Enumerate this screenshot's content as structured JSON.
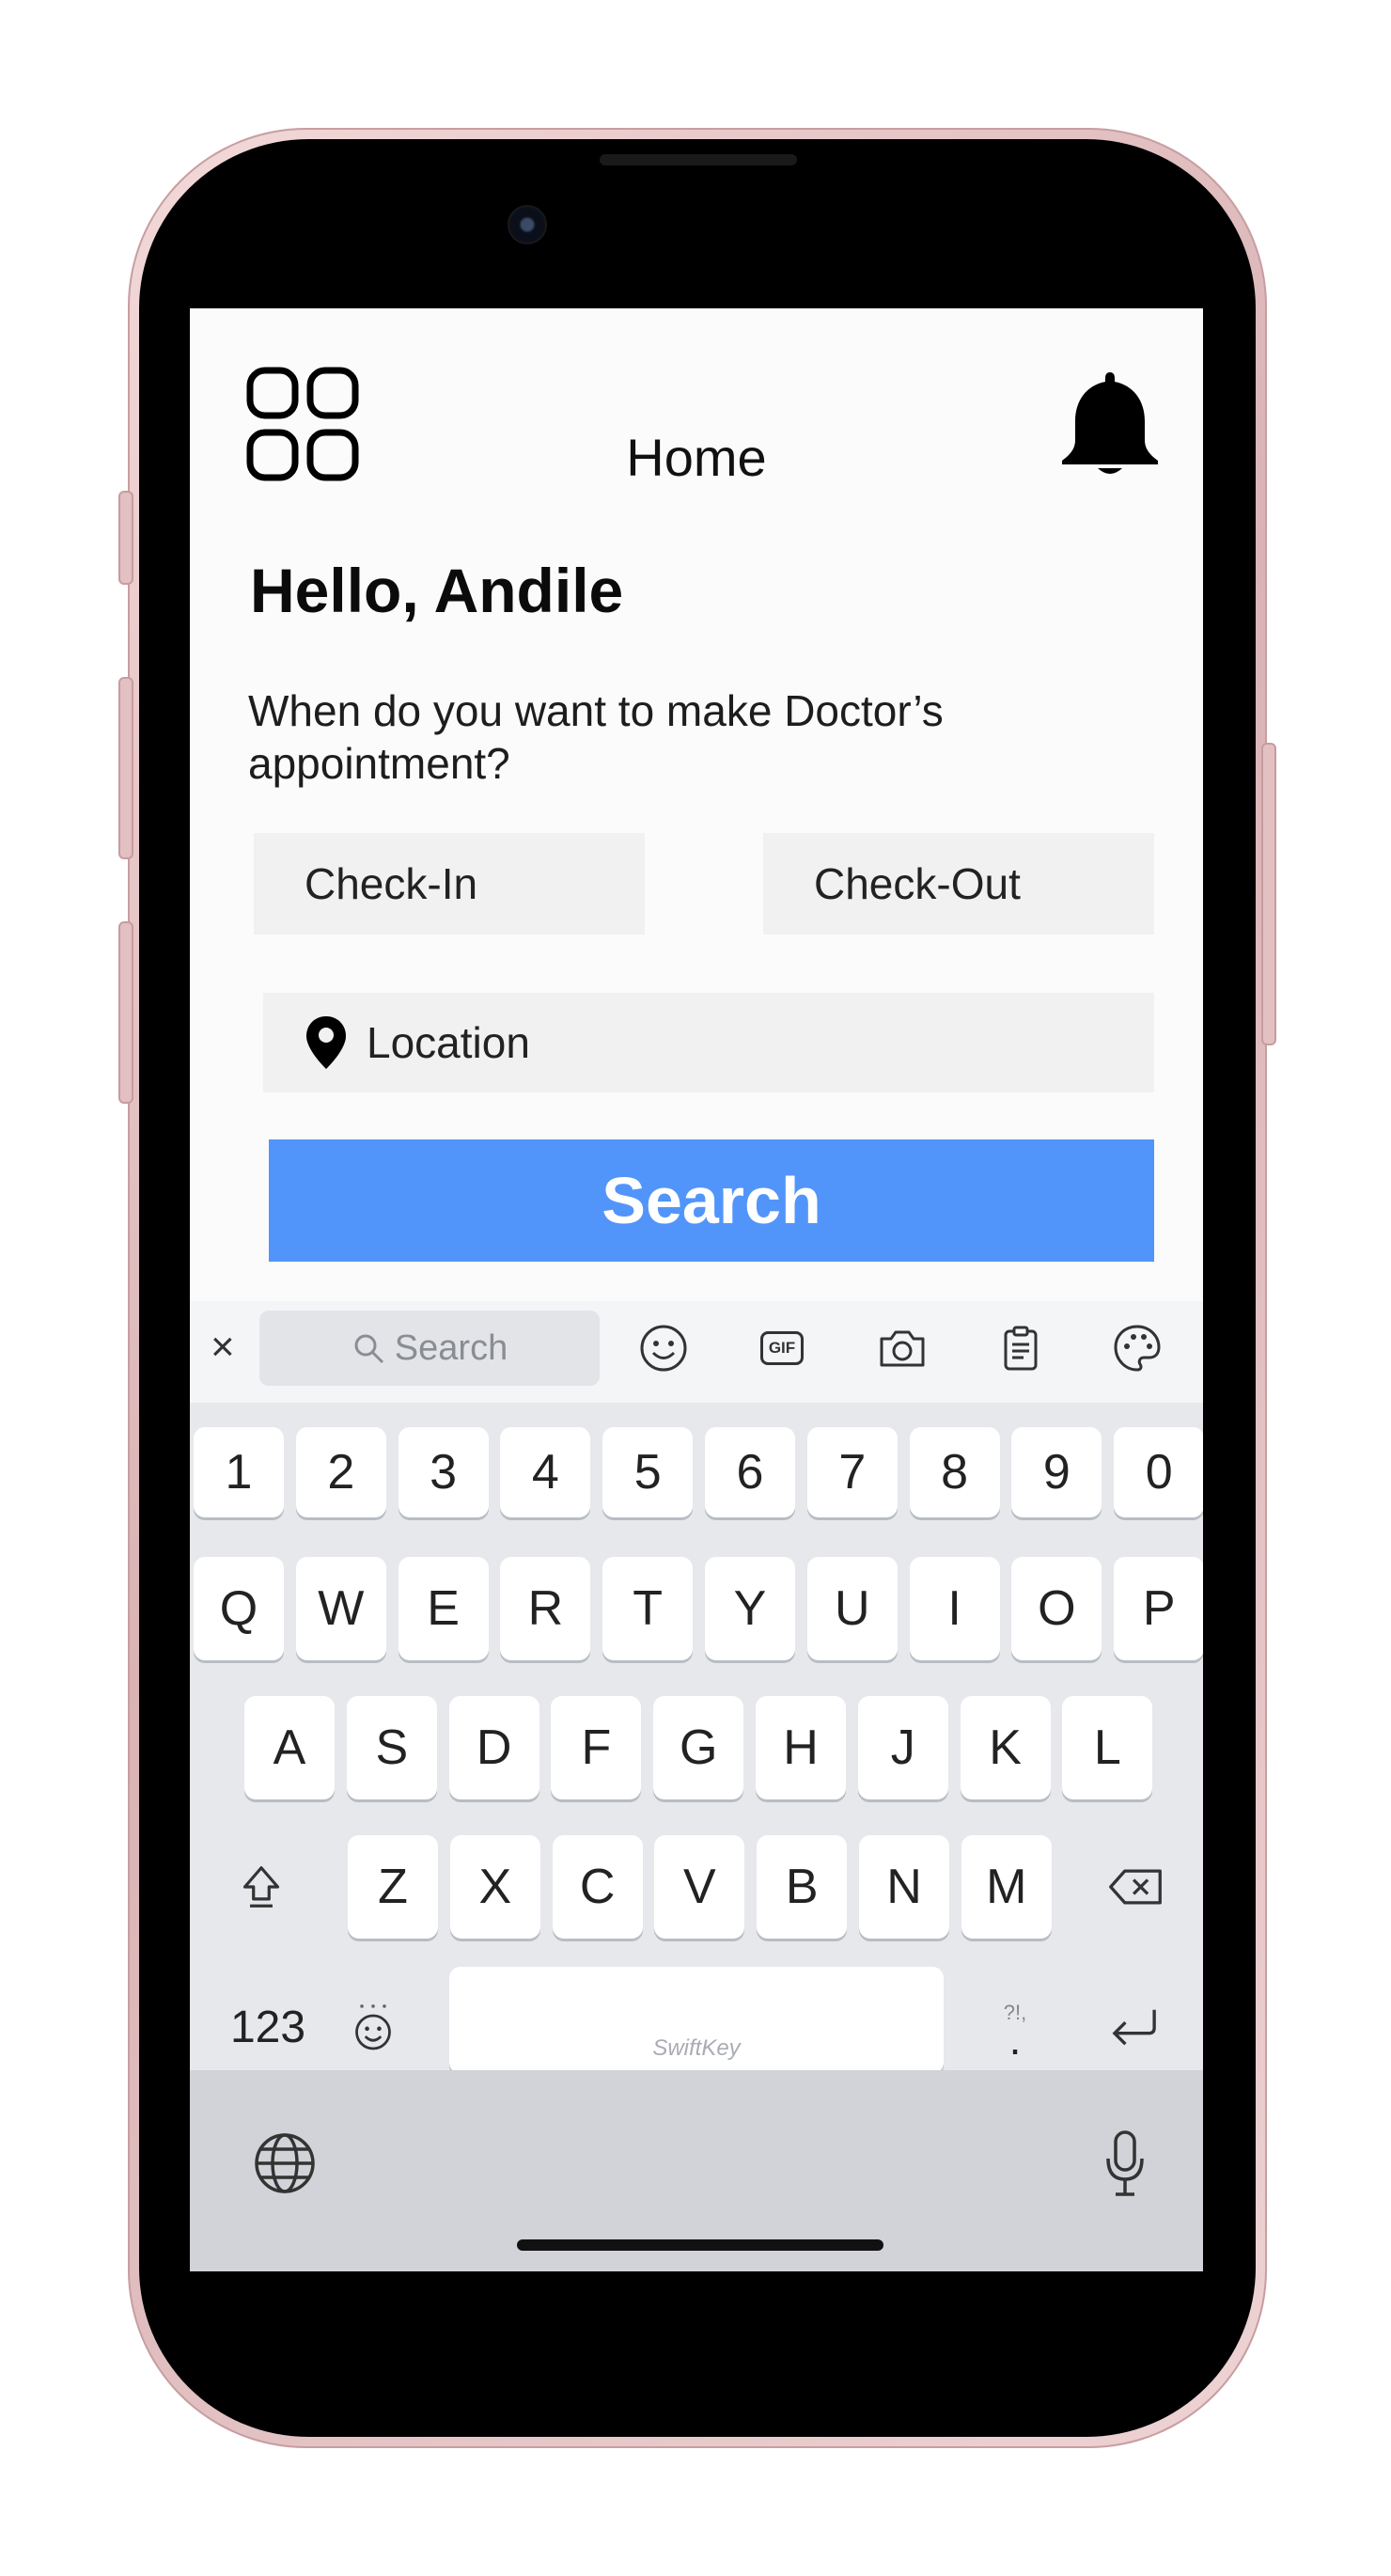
{
  "header": {
    "title": "Home",
    "menu_icon": "grid-menu-icon",
    "notification_icon": "bell-icon"
  },
  "greeting": "Hello, Andile",
  "prompt": "When do you want to make Doctor’s appointment?",
  "fields": {
    "check_in": "Check-In",
    "check_out": "Check-Out",
    "location": "Location"
  },
  "search_button": "Search",
  "colors": {
    "accent": "#5295fa",
    "field_bg": "#f1f1f1",
    "screen_bg": "#fbfbfb"
  },
  "keyboard": {
    "search_placeholder": "Search",
    "close": "×",
    "toolbar_icons": [
      "emoji-icon",
      "gif-icon",
      "camera-icon",
      "clipboard-icon",
      "palette-icon"
    ],
    "gif_label": "GIF",
    "row_numbers": [
      "1",
      "2",
      "3",
      "4",
      "5",
      "6",
      "7",
      "8",
      "9",
      "0"
    ],
    "row_1": [
      "Q",
      "W",
      "E",
      "R",
      "T",
      "Y",
      "U",
      "I",
      "O",
      "P"
    ],
    "row_2": [
      "A",
      "S",
      "D",
      "F",
      "G",
      "H",
      "J",
      "K",
      "L"
    ],
    "row_3": [
      "Z",
      "X",
      "C",
      "V",
      "B",
      "N",
      "M"
    ],
    "numbers_key": "123",
    "space_brand": "SwiftKey",
    "punct_top": "?!,",
    "punct_main": "."
  }
}
